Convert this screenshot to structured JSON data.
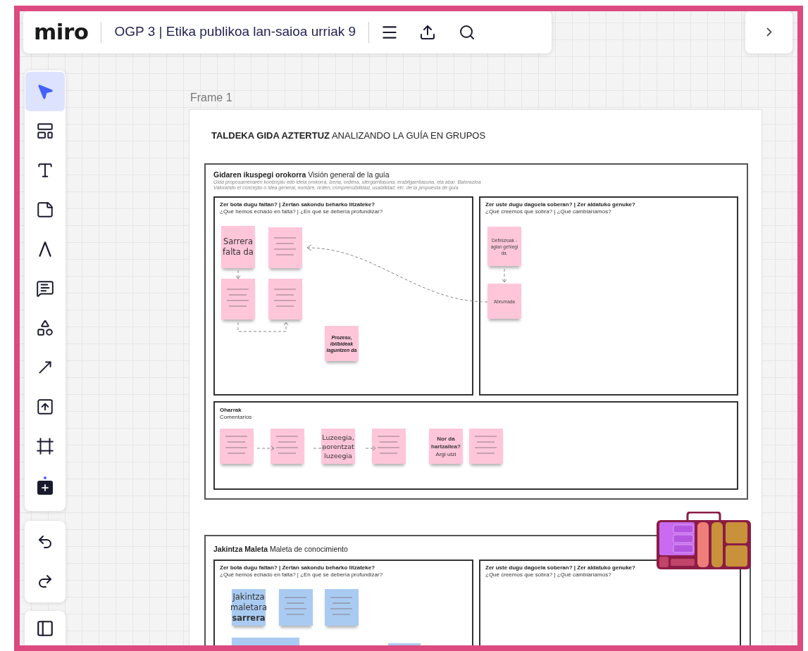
{
  "top_bar": {
    "logo": "miro",
    "board_title": "OGP 3 | Etika publikoa lan-saioa urriak 9"
  },
  "tools": [
    {
      "kind": "select",
      "selected": true
    },
    {
      "kind": "template",
      "selected": false
    },
    {
      "kind": "text",
      "selected": false
    },
    {
      "kind": "sticky",
      "selected": false
    },
    {
      "kind": "pen",
      "selected": false
    },
    {
      "kind": "comment",
      "selected": false
    },
    {
      "kind": "shapes",
      "selected": false
    },
    {
      "kind": "connector",
      "selected": false
    },
    {
      "kind": "upload",
      "selected": false
    },
    {
      "kind": "frame",
      "selected": false
    },
    {
      "kind": "more",
      "selected": false
    }
  ],
  "history_tools": [
    {
      "kind": "undo"
    },
    {
      "kind": "redo"
    }
  ],
  "frame": {
    "label": "Frame 1",
    "title": "**TALDEKA GIDA AZTERTUZ** ANALIZANDO LA GUÍA EN GRUPOS",
    "sections": [
      {
        "title": "**Gidaren ikuspegi orokorra** Visión general de la guía",
        "description": [
          "Gida proposamenaren kontzeptu edo ideia orokorra, izena, ordena, ulergarritasuna, erabilgarritasuna, eta abar. Balorazioa",
          "Valorando el concepto o idea general, nombre, orden, comprensibilidad, usabilidad, etc. de la propuesta de guía"
        ],
        "boxes": [
          {
            "heading": "Zer bota dugu faltan? | Zertan sakondu beharko litzateke?",
            "subheading": "¿Qué hemos echado en falta? | ¿En qué se debería profundizar?",
            "notes": [
              {
                "text": "Sarrera falta da",
                "color": "#ffc6da"
              },
              {
                "color": "#ffc6da"
              },
              {
                "color": "#ffc6da"
              },
              {
                "color": "#ffc6da"
              },
              {
                "text": "Prozesu, ibilbideak laguntzen da",
                "color": "#ffc6da"
              }
            ]
          },
          {
            "heading": "Zer uste dugu dagoela soberan? | Zer aldatuko genuke?",
            "subheading": "¿Qué creemos que sobra? | ¿Qué cambiaríamos?",
            "notes": [
              {
                "text": "Definizioak - agian gehiegi da.",
                "color": "#ffc6da"
              },
              {
                "text": "Abrumada",
                "color": "#ffc6da"
              }
            ]
          }
        ],
        "comments": {
          "heading": "Oharrak",
          "subheading": "Comentarios",
          "notes": [
            {
              "color": "#ffc6da"
            },
            {
              "color": "#ffc6da"
            },
            {
              "text": "Luzeegia, norentzat luzeegia",
              "color": "#ffc6da"
            },
            {
              "color": "#ffc6da"
            },
            {
              "text": "**Nor da hartzailea?** Argi utzi",
              "color": "#ffc6da"
            },
            {
              "color": "#ffc6da"
            }
          ]
        }
      },
      {
        "title": "**Jakintza Maleta** Maleta de conocimiento",
        "boxes": [
          {
            "heading": "Zer bota dugu faltan? | Zertan sakondu beharko litzateke?",
            "subheading": "¿Qué hemos echado en falta? | ¿En qué se debería profundizar?",
            "notes": [
              {
                "text": "Jakintza maletara **sarrera**",
                "color": "#a9cbf2"
              },
              {
                "color": "#a9cbf2"
              },
              {
                "color": "#a9cbf2"
              },
              {
                "color": "#a9cbf2"
              },
              {
                "color": "#a9cbf2"
              }
            ]
          },
          {
            "heading": "Zer uste dugu dagoela soberan? | Zer aldatuko genuke?",
            "subheading": "¿Qué creemos que sobra? | ¿Qué cambiaríamos?"
          }
        ]
      }
    ]
  }
}
